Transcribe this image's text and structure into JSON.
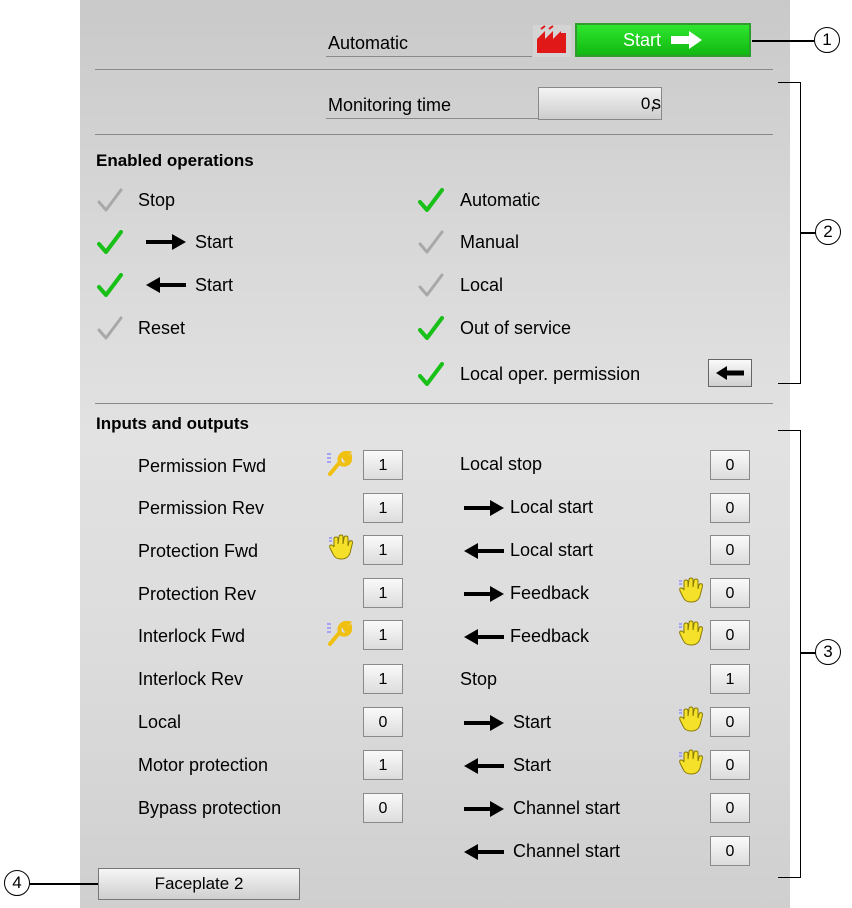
{
  "header": {
    "mode_label": "Automatic",
    "start_button_label": "Start",
    "start_button_color": "#1ad21a",
    "monitoring_label": "Monitoring time",
    "monitoring_value": "0,",
    "monitoring_unit": "s"
  },
  "enabled_operations": {
    "title": "Enabled operations",
    "left": [
      {
        "label": "Stop",
        "enabled": false
      },
      {
        "label": "Start",
        "enabled": true,
        "arrow": "right"
      },
      {
        "label": "Start",
        "enabled": true,
        "arrow": "left"
      },
      {
        "label": "Reset",
        "enabled": false
      }
    ],
    "right": [
      {
        "label": "Automatic",
        "enabled": true
      },
      {
        "label": "Manual",
        "enabled": false
      },
      {
        "label": "Local",
        "enabled": false
      },
      {
        "label": "Out of service",
        "enabled": true
      },
      {
        "label": "Local oper. permission",
        "enabled": true
      }
    ]
  },
  "io": {
    "title": "Inputs and outputs",
    "left": [
      {
        "label": "Permission Fwd",
        "value": "1",
        "icon": "wrench-icon"
      },
      {
        "label": "Permission Rev",
        "value": "1"
      },
      {
        "label": "Protection Fwd",
        "value": "1",
        "icon": "hand-icon"
      },
      {
        "label": "Protection Rev",
        "value": "1"
      },
      {
        "label": "Interlock Fwd",
        "value": "1",
        "icon": "wrench-icon"
      },
      {
        "label": "Interlock Rev",
        "value": "1"
      },
      {
        "label": "Local",
        "value": "0"
      },
      {
        "label": "Motor protection",
        "value": "1"
      },
      {
        "label": "Bypass protection",
        "value": "0"
      }
    ],
    "right": [
      {
        "label": "Local stop",
        "value": "0"
      },
      {
        "label": "Local start",
        "value": "0",
        "arrow": "right"
      },
      {
        "label": "Local start",
        "value": "0",
        "arrow": "left"
      },
      {
        "label": "Feedback",
        "value": "0",
        "arrow": "right",
        "icon": "hand-icon"
      },
      {
        "label": "Feedback",
        "value": "0",
        "arrow": "left",
        "icon": "hand-icon"
      },
      {
        "label": "Stop",
        "value": "1"
      },
      {
        "label": "Start",
        "value": "0",
        "arrow": "right",
        "icon": "hand-icon"
      },
      {
        "label": "Start",
        "value": "0",
        "arrow": "left",
        "icon": "hand-icon"
      },
      {
        "label": "Channel start",
        "value": "0",
        "arrow": "right"
      },
      {
        "label": "Channel start",
        "value": "0",
        "arrow": "left"
      }
    ]
  },
  "faceplate_button_label": "Faceplate 2",
  "callouts": [
    "1",
    "2",
    "3",
    "4"
  ]
}
